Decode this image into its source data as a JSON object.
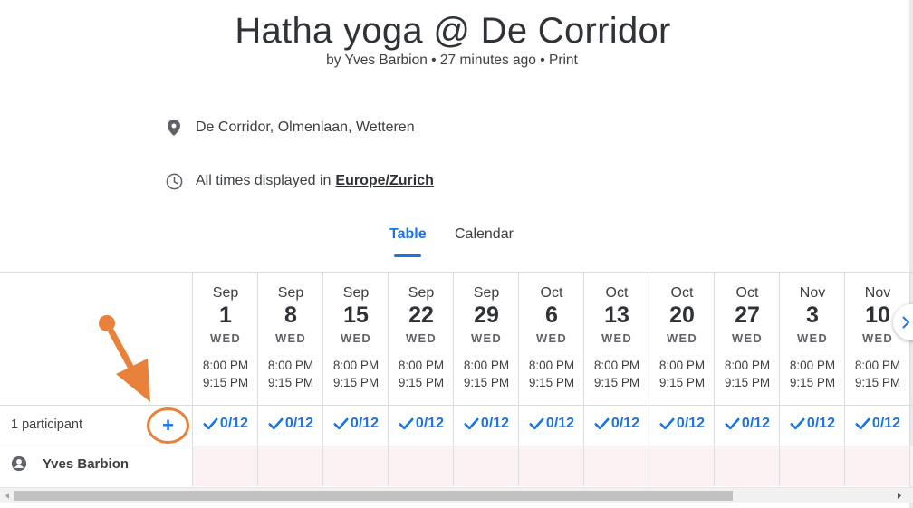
{
  "header": {
    "title": "Hatha yoga @ De Corridor",
    "author_prefix": "by Yves Barbion",
    "separator": "•",
    "time_ago": "27 minutes ago",
    "print_label": "Print"
  },
  "location": {
    "text": "De Corridor, Olmenlaan, Wetteren",
    "icon": "map-pin-icon"
  },
  "timezone": {
    "prefix": "All times displayed in",
    "zone": "Europe/Zurich",
    "icon": "clock-icon"
  },
  "tabs": [
    {
      "label": "Table",
      "active": true
    },
    {
      "label": "Calendar",
      "active": false
    }
  ],
  "table": {
    "participants_label": "1 participant",
    "add_label": "+",
    "dates": [
      {
        "month": "Sep",
        "day": "1",
        "weekday": "WED",
        "start": "8:00 PM",
        "end": "9:15 PM",
        "count": "0/12"
      },
      {
        "month": "Sep",
        "day": "8",
        "weekday": "WED",
        "start": "8:00 PM",
        "end": "9:15 PM",
        "count": "0/12"
      },
      {
        "month": "Sep",
        "day": "15",
        "weekday": "WED",
        "start": "8:00 PM",
        "end": "9:15 PM",
        "count": "0/12"
      },
      {
        "month": "Sep",
        "day": "22",
        "weekday": "WED",
        "start": "8:00 PM",
        "end": "9:15 PM",
        "count": "0/12"
      },
      {
        "month": "Sep",
        "day": "29",
        "weekday": "WED",
        "start": "8:00 PM",
        "end": "9:15 PM",
        "count": "0/12"
      },
      {
        "month": "Oct",
        "day": "6",
        "weekday": "WED",
        "start": "8:00 PM",
        "end": "9:15 PM",
        "count": "0/12"
      },
      {
        "month": "Oct",
        "day": "13",
        "weekday": "WED",
        "start": "8:00 PM",
        "end": "9:15 PM",
        "count": "0/12"
      },
      {
        "month": "Oct",
        "day": "20",
        "weekday": "WED",
        "start": "8:00 PM",
        "end": "9:15 PM",
        "count": "0/12"
      },
      {
        "month": "Oct",
        "day": "27",
        "weekday": "WED",
        "start": "8:00 PM",
        "end": "9:15 PM",
        "count": "0/12"
      },
      {
        "month": "Nov",
        "day": "3",
        "weekday": "WED",
        "start": "8:00 PM",
        "end": "9:15 PM",
        "count": "0/12"
      },
      {
        "month": "Nov",
        "day": "10",
        "weekday": "WED",
        "start": "8:00 PM",
        "end": "9:15 PM",
        "count": "0/12"
      }
    ],
    "participants": [
      {
        "name": "Yves Barbion",
        "icon": "user-avatar-icon"
      }
    ]
  },
  "colors": {
    "accent": "#1a73e8",
    "annotation": "#e8813a",
    "unavailable_cell": "#fdf2f3"
  }
}
